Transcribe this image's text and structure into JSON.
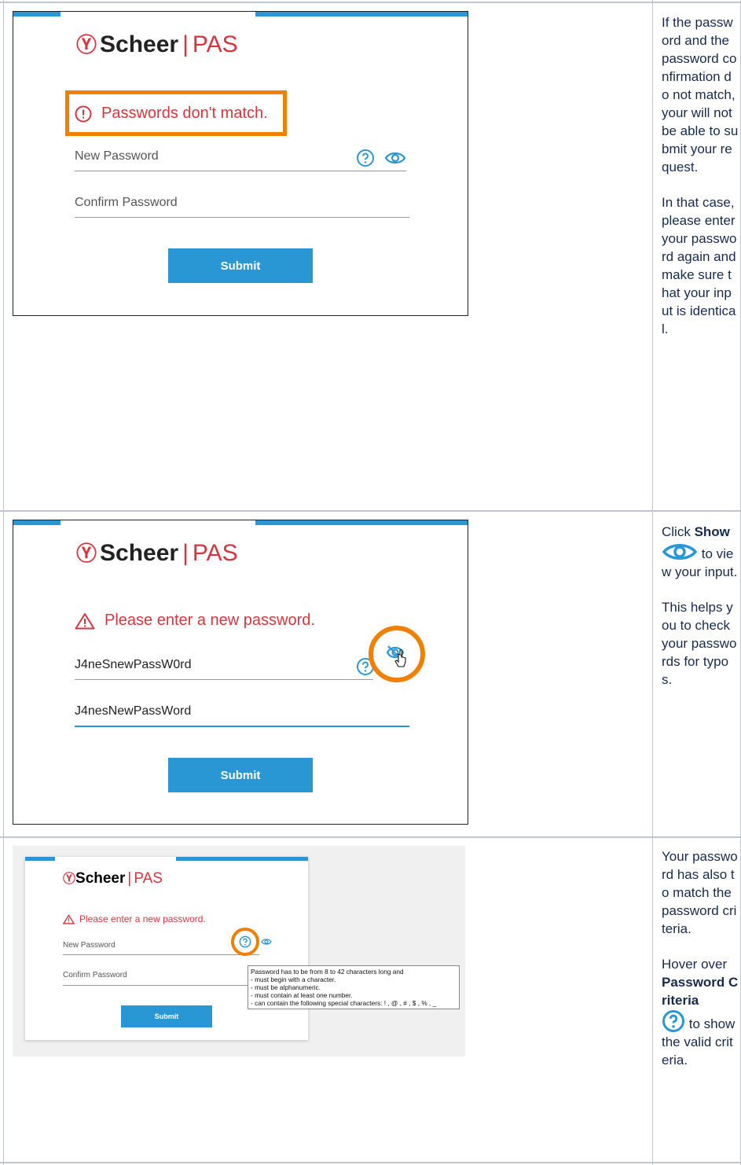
{
  "brand": {
    "name": "Scheer",
    "separator": "|",
    "product": "PAS"
  },
  "row1": {
    "error": "Passwords don't match.",
    "new_password_placeholder": "New Password",
    "confirm_password_placeholder": "Confirm Password",
    "submit": "Submit",
    "description": [
      "If the password and the password confirmation do not match, your will not be able to submit your request.",
      "In that case, please enter your password again and make sure that your input is identical."
    ]
  },
  "row2": {
    "warning": "Please enter a new password.",
    "new_password_value": "J4neSnewPassW0rd",
    "confirm_password_value": "J4nesNewPassWord",
    "submit": "Submit",
    "desc_prefix": "Click ",
    "desc_bold": "Show",
    "desc_after_icon": " to view your input.",
    "desc_p2": "This helps you to check your passwords for typos."
  },
  "row3": {
    "warning": "Please enter a new password.",
    "new_password_placeholder": "New Password",
    "confirm_password_placeholder": "Confirm Password",
    "submit": "Submit",
    "tooltip_lines": [
      "Password has to be from 8 to 42 characters long and",
      "- must begin with a character.",
      "- must be alphanumeric.",
      "- must contain at least one number.",
      "- can contain the following special characters: ! , @ , # , $ , % , _"
    ],
    "desc_p1": "Your password has also to match the password criteria.",
    "desc_prefix": "Hover over ",
    "desc_bold": "Password Criteria",
    "desc_after_icon": " to show the valid criteria."
  },
  "colors": {
    "brand_red": "#d8343f",
    "accent_blue": "#2a97d5",
    "highlight_orange": "#ef8000"
  }
}
